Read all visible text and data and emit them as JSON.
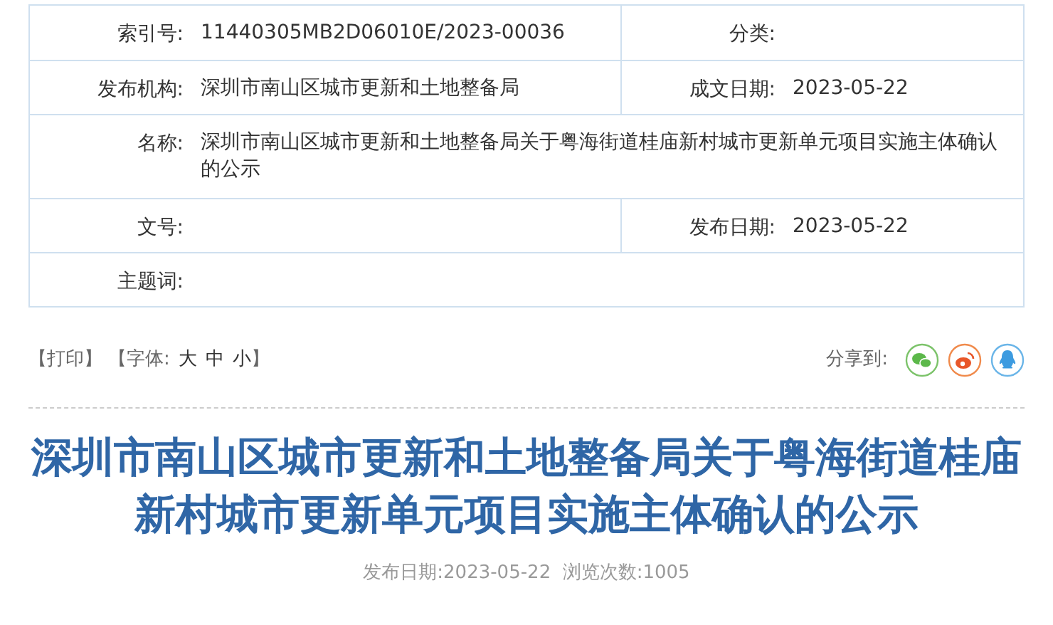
{
  "info_table": {
    "rows": [
      {
        "fields": [
          {
            "label": "索引号:",
            "value": "11440305MB2D06010E/2023-00036"
          },
          {
            "label": "分类:"
          }
        ]
      },
      {
        "fields": [
          {
            "label": "发布机构:",
            "value": "深圳市南山区城市更新和土地整备局"
          },
          {
            "label": "成文日期:",
            "value": "2023-05-22"
          }
        ]
      },
      {
        "fields": [
          {
            "label": "名称:",
            "value": "深圳市南山区城市更新和土地整备局关于粤海街道桂庙新村城市更新单元项目实施主体确认的公示"
          }
        ]
      },
      {
        "fields": [
          {
            "label": "文号:"
          },
          {
            "label": "发布日期:",
            "value": "2023-05-22"
          }
        ]
      },
      {
        "fields": [
          {
            "label": "主题词:"
          }
        ]
      }
    ]
  },
  "toolbar": {
    "print": "【打印】",
    "font_label": "【字体:",
    "font_sizes": [
      "大",
      "中",
      "小"
    ],
    "font_close": "】",
    "share_label": "分享到:"
  },
  "article": {
    "title": "深圳市南山区城市更新和土地整备局关于粤海街道桂庙新村城市更新单元项目实施主体确认的公示",
    "meta": "发布日期:2023-05-22  浏览次数:1005"
  }
}
